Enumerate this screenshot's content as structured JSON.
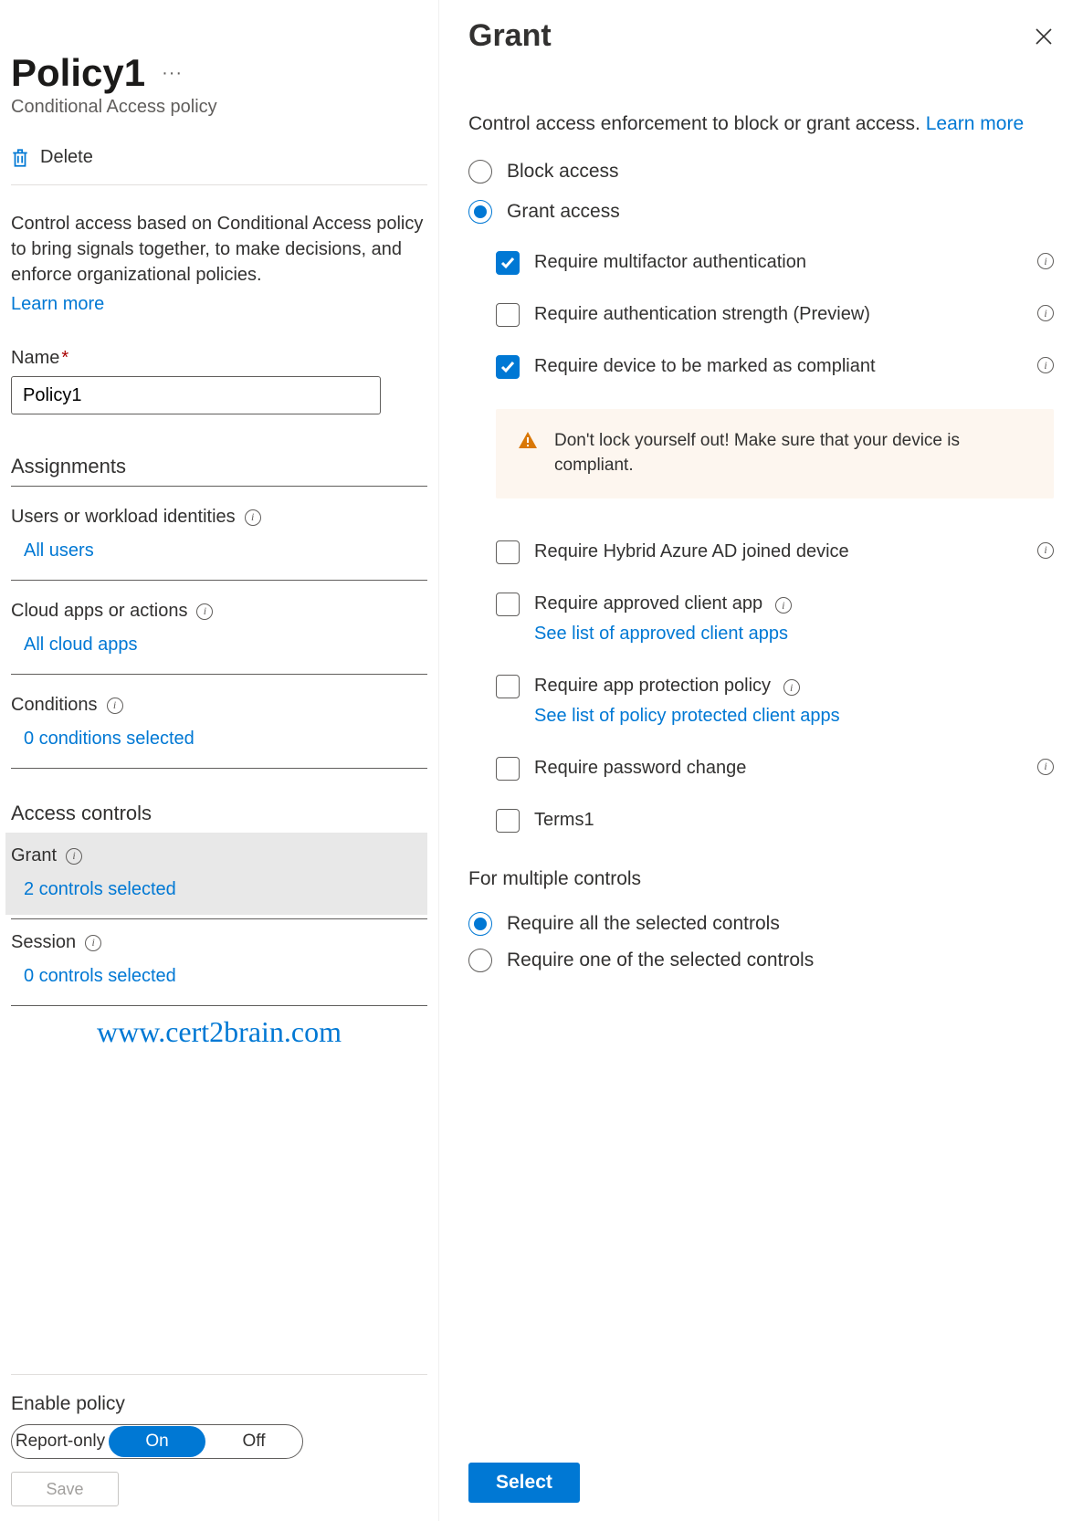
{
  "left": {
    "title": "Policy1",
    "subtitle": "Conditional Access policy",
    "delete_label": "Delete",
    "description": "Control access based on Conditional Access policy to bring signals together, to make decisions, and enforce organizational policies.",
    "learn_more": "Learn more",
    "name_label": "Name",
    "name_value": "Policy1",
    "assignments_header": "Assignments",
    "users_label": "Users or workload identities",
    "users_value": "All users",
    "cloudapps_label": "Cloud apps or actions",
    "cloudapps_value": "All cloud apps",
    "conditions_label": "Conditions",
    "conditions_value": "0 conditions selected",
    "access_controls_header": "Access controls",
    "grant_label": "Grant",
    "grant_value": "2 controls selected",
    "session_label": "Session",
    "session_value": "0 controls selected",
    "watermark": "www.cert2brain.com",
    "enable_policy_label": "Enable policy",
    "toggle": {
      "report_only": "Report-only",
      "on": "On",
      "off": "Off",
      "selected": "On"
    },
    "save_label": "Save"
  },
  "right": {
    "title": "Grant",
    "description": "Control access enforcement to block or grant access.",
    "learn_more": "Learn more",
    "radio_block": "Block access",
    "radio_grant": "Grant access",
    "radio_selected": "grant",
    "checkboxes": {
      "mfa": {
        "label": "Require multifactor authentication",
        "checked": true
      },
      "auth_strength": {
        "label": "Require authentication strength (Preview)",
        "checked": false
      },
      "compliant": {
        "label": "Require device to be marked as compliant",
        "checked": true
      },
      "hybrid": {
        "label": "Require Hybrid Azure AD joined device",
        "checked": false
      },
      "approved_app": {
        "label": "Require approved client app",
        "checked": false,
        "sublink": "See list of approved client apps"
      },
      "app_protection": {
        "label": "Require app protection policy",
        "checked": false,
        "sublink": "See list of policy protected client apps"
      },
      "password": {
        "label": "Require password change",
        "checked": false
      },
      "terms1": {
        "label": "Terms1",
        "checked": false
      }
    },
    "warning": "Don't lock yourself out! Make sure that your device is compliant.",
    "multi_label": "For multiple controls",
    "multi_radio": {
      "all": "Require all the selected controls",
      "one": "Require one of the selected controls",
      "selected": "all"
    },
    "select_button": "Select"
  }
}
